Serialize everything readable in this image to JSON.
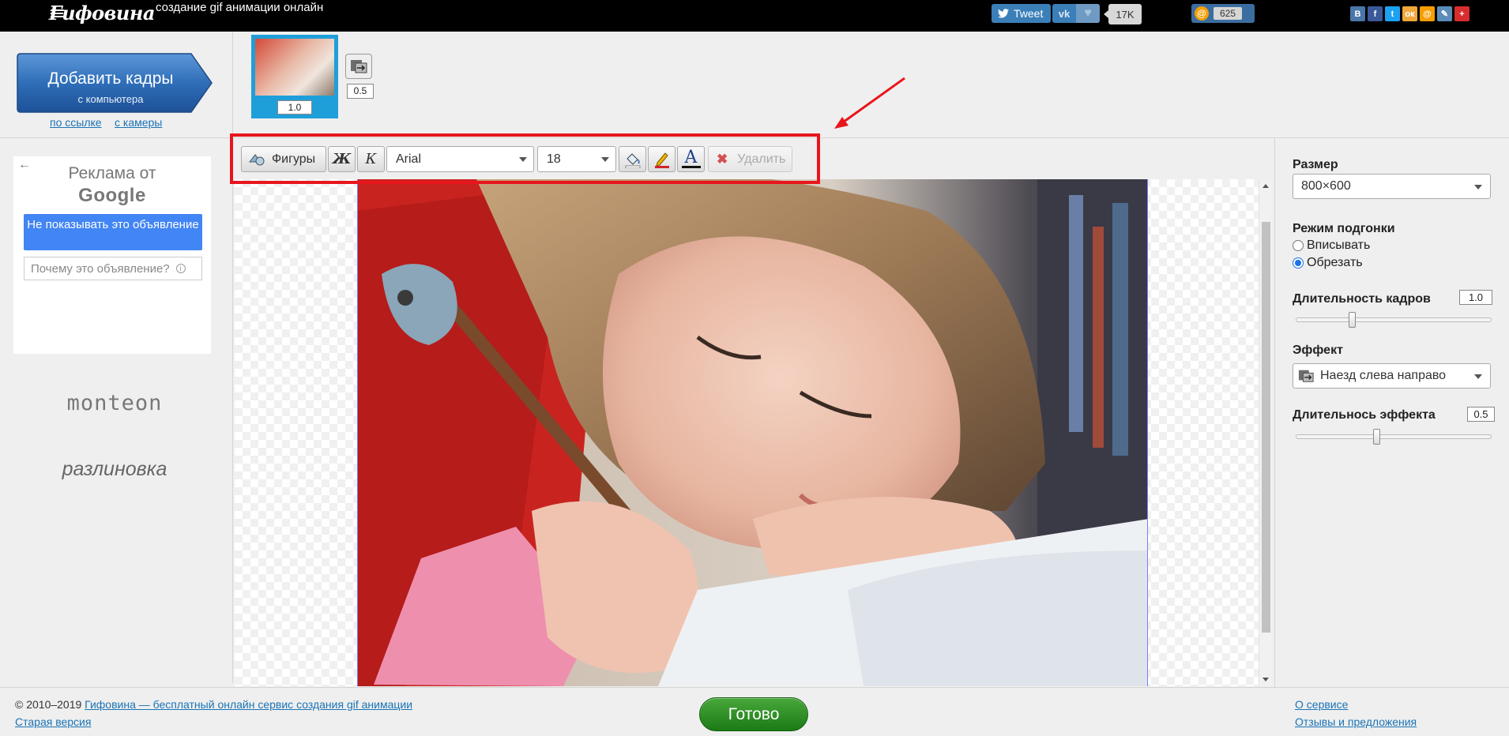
{
  "topbar": {
    "logo": "Гифовина",
    "tagline": "создание gif анимации онлайн",
    "tweet_label": "Tweet",
    "vk_label": "vk",
    "like_count": "17K",
    "mail_count": "625",
    "share_icons": [
      {
        "name": "vk-share-icon",
        "glyph": "В",
        "color": "#4a76a8"
      },
      {
        "name": "facebook-share-icon",
        "glyph": "f",
        "color": "#3b5998"
      },
      {
        "name": "twitter-share-icon",
        "glyph": "t",
        "color": "#1da1f2"
      },
      {
        "name": "odnoklassniki-share-icon",
        "glyph": "ок",
        "color": "#f2a73b"
      },
      {
        "name": "mail-share-icon",
        "glyph": "@",
        "color": "#f59e00"
      },
      {
        "name": "livejournal-share-icon",
        "glyph": "✎",
        "color": "#5b8db8"
      },
      {
        "name": "more-share-icon",
        "glyph": "+",
        "color": "#d62d2d"
      }
    ]
  },
  "header": {
    "add_frames_title": "Добавить кадры",
    "add_frames_subtitle": "с компьютера",
    "by_link": "по ссылке",
    "from_camera": "с камеры",
    "frame_duration_value": "1.0",
    "effect_duration_value": "0.5"
  },
  "ad": {
    "back_glyph": "←",
    "title": "Реклама от",
    "brand": "Google",
    "hide_button": "Не показывать это объявление",
    "why_label": "Почему это объявление?",
    "info_glyph": "i"
  },
  "left_brands": {
    "brand1": "monteon",
    "brand2": "разлиновка"
  },
  "toolbar": {
    "figures_label": "Фигуры",
    "bold_label": "Ж",
    "italic_label": "К",
    "font": "Arial",
    "size": "18",
    "text_color_glyph": "A",
    "delete_label": "Удалить",
    "delete_glyph": "✖"
  },
  "right_panel": {
    "size_label": "Размер",
    "size_value": "800×600",
    "fit_label": "Режим подгонки",
    "fit_options": [
      "Вписывать",
      "Обрезать"
    ],
    "fit_selected": 1,
    "frame_duration_label": "Длительность кадров",
    "frame_duration_value": "1.0",
    "frame_duration_slider": 0.28,
    "effect_label": "Эффект",
    "effect_value": "Наезд слева направо",
    "effect_duration_label": "Длительнось эффекта",
    "effect_duration_value": "0.5",
    "effect_duration_slider": 0.41
  },
  "footer": {
    "copyright": "© 2010–2019",
    "site_link": "Гифовина — бесплатный онлайн сервис создания gif анимации",
    "old_version": "Старая версия",
    "done": "Готово",
    "about": "О сервисе",
    "reviews": "Отзывы и предложения"
  },
  "colors": {
    "accent_red": "#e8161c",
    "done_green": "#2e8f25",
    "link_blue": "#1a73b6",
    "google_blue": "#4285f4"
  }
}
